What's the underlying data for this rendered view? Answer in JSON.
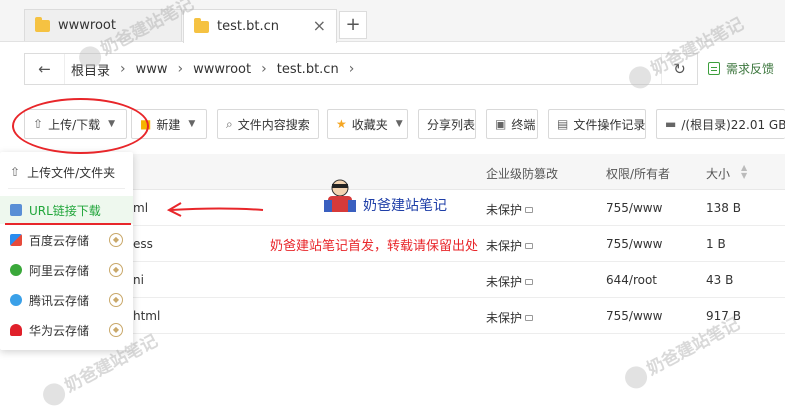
{
  "tabs": [
    {
      "label": "wwwroot",
      "active": false
    },
    {
      "label": "test.bt.cn",
      "active": true
    }
  ],
  "tab_close": "×",
  "tab_add": "+",
  "address": {
    "back_icon": "←",
    "crumbs": [
      "根目录",
      "www",
      "wwwroot",
      "test.bt.cn"
    ],
    "separator": "›",
    "refresh_icon": "↻"
  },
  "feedback_label": "需求反馈",
  "toolbar": {
    "upload": "上传/下载",
    "new": "新建",
    "search": "文件内容搜索",
    "favorites": "收藏夹",
    "share_list": "分享列表",
    "terminal": "终端",
    "op_log": "文件操作记录",
    "disk": "/(根目录)22.01 GB"
  },
  "table": {
    "headers": {
      "tamper": "企业级防篡改",
      "perm": "权限/所有者",
      "size": "大小"
    },
    "rows": [
      {
        "name": "ml",
        "tamper": "未保护",
        "perm": "755/www",
        "size": "138 B"
      },
      {
        "name": "ess",
        "tamper": "未保护",
        "perm": "755/www",
        "size": "1 B"
      },
      {
        "name": "ni",
        "tamper": "未保护",
        "perm": "644/root",
        "size": "43 B"
      },
      {
        "name": "html",
        "tamper": "未保护",
        "perm": "755/www",
        "size": "917 B"
      }
    ]
  },
  "dropdown": {
    "items": [
      {
        "label": "上传文件/文件夹",
        "icon": "upload-icon"
      },
      {
        "label": "URL链接下载",
        "icon": "link-icon"
      },
      {
        "label": "百度云存储",
        "icon": "baidu-cloud-icon"
      },
      {
        "label": "阿里云存储",
        "icon": "aliyun-icon"
      },
      {
        "label": "腾讯云存储",
        "icon": "tencent-cloud-icon"
      },
      {
        "label": "华为云存储",
        "icon": "huawei-cloud-icon"
      }
    ]
  },
  "annotation": {
    "blue_text": "奶爸建站笔记",
    "red_text": "奶爸建站笔记首发，转载请保留出处"
  },
  "watermark": "奶爸建站笔记",
  "colors": {
    "accent": "#20a53a",
    "annotation_red": "#e8262a",
    "annotation_blue": "#1f3fa8"
  }
}
